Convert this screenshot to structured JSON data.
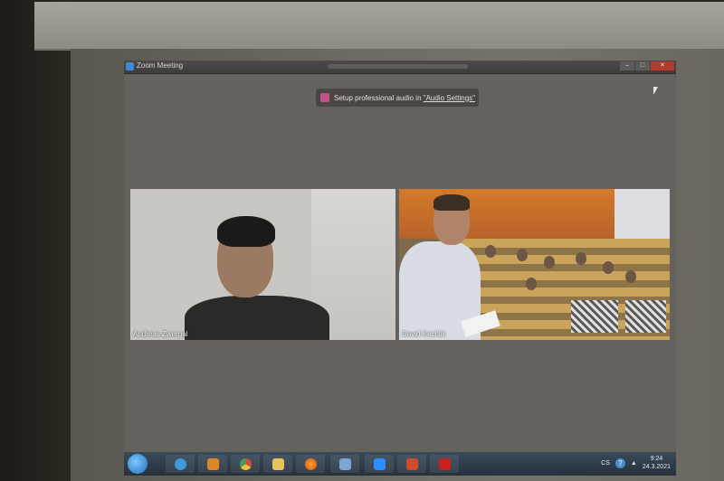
{
  "window": {
    "title": "Zoom Meeting",
    "controls": [
      "–",
      "□",
      "✕"
    ]
  },
  "notice": {
    "prefix": "Setup professional audio in ",
    "link": "\"Audio Settings\""
  },
  "participants": [
    {
      "name": "Andreas Zwergal"
    },
    {
      "name": "David Kachlik"
    }
  ],
  "taskbar": {
    "apps": [
      "internet-explorer-icon",
      "media-player-icon",
      "chrome-icon",
      "file-explorer-icon",
      "firefox-icon",
      "remote-desktop-icon",
      "zoom-icon",
      "powerpoint-icon",
      "acrobat-icon"
    ],
    "language": "CS",
    "help": "?",
    "time": "9:24",
    "date": "24.3.2021"
  },
  "colors": {
    "accent_blue": "#3d8bd8",
    "close_red": "#b03a2e",
    "notice_icon": "#c2528a"
  }
}
